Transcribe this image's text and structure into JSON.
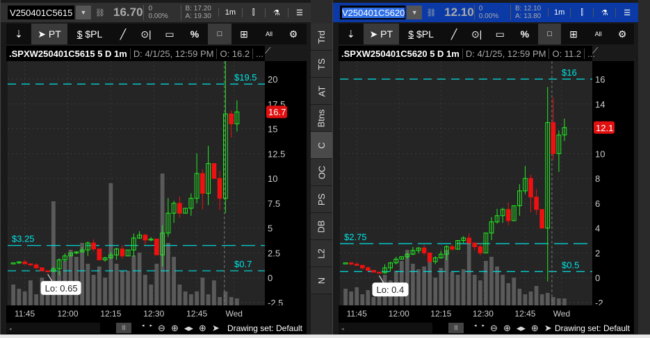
{
  "panels": [
    {
      "symbol": "V250401C5615",
      "last": "16.70",
      "change": "0",
      "change_pct": "0.00%",
      "bid": "B: 17.20",
      "ask": "A: 19.30",
      "interval": "1m",
      "toolbar": {
        "pin": "⇣",
        "pointer": "PT",
        "pl": "$PL",
        "percent": "%",
        "all": "All"
      },
      "title": ".SPXW250401C5615 5 D 1m",
      "date": "D: 4/1/25, 12:59 PM",
      "open": "O: 16.2",
      "more": "...",
      "price_tag": "16.7",
      "lo_label": "Lo: 0.65",
      "levels": [
        {
          "label": "$19.5",
          "value": 19.5
        },
        {
          "label": "$3.25",
          "value": 3.25
        },
        {
          "label": "$0.7",
          "value": 0.7
        }
      ],
      "yticks": [
        "20",
        "17.5",
        "15",
        "12.5",
        "10",
        "7.5",
        "5",
        "2.5",
        "0",
        "-2.5"
      ],
      "xticks": [
        "11:45",
        "12:00",
        "12:15",
        "12:30",
        "12:45",
        "Wed"
      ],
      "drawing_set": "Drawing set: Default"
    },
    {
      "symbol": "V250401C5620",
      "last": "12.10",
      "change": "0",
      "change_pct": "0.00%",
      "bid": "B: 12.10",
      "ask": "A: 13.80",
      "interval": "1m",
      "toolbar": {
        "pin": "⇣",
        "pointer": "PT",
        "pl": "$PL",
        "percent": "%",
        "all": "All"
      },
      "title": ".SPXW250401C5620 5 D 1m",
      "date": "D: 4/1/25, 12:59 PM",
      "open": "O: 11.2",
      "more": "...",
      "price_tag": "12.1",
      "lo_label": "Lo: 0.4",
      "levels": [
        {
          "label": "$16",
          "value": 16
        },
        {
          "label": "$2.75",
          "value": 2.75
        },
        {
          "label": "$0.5",
          "value": 0.5
        }
      ],
      "yticks": [
        "16",
        "14",
        "12",
        "10",
        "8",
        "6",
        "4",
        "2",
        "0",
        "-2"
      ],
      "xticks": [
        "11:45",
        "12:00",
        "12:15",
        "12:30",
        "12:45",
        "Wed"
      ],
      "drawing_set": "Drawing set: Default"
    }
  ],
  "side_tabs": [
    "Trd",
    "TS",
    "AT",
    "Btns",
    "C",
    "OC",
    "PS",
    "DB",
    "L2",
    "N"
  ],
  "active_tab": "C",
  "colors": {
    "up": "#22ee22",
    "down": "#ee1111",
    "level": "#00e5e5",
    "volume": "#5a5a5a",
    "tag": "#e01010"
  },
  "chart_data": [
    {
      "type": "candlestick",
      "title": ".SPXW250401C5615 5 D 1m",
      "ylim": [
        -2.5,
        21
      ],
      "yticks": [
        20,
        17.5,
        15,
        12.5,
        10,
        7.5,
        5,
        2.5,
        0,
        -2.5
      ],
      "x_start": "11:40",
      "bar_minutes": 2,
      "close": [
        1.5,
        1.6,
        1.4,
        1.3,
        1.0,
        0.7,
        0.65,
        0.9,
        1.8,
        2.2,
        2.5,
        2.6,
        2.8,
        3.5,
        2.9,
        1.8,
        2.0,
        2.3,
        2.9,
        2.2,
        2.8,
        4.0,
        4.3,
        3.8,
        3.9,
        2.3,
        4.5,
        6.5,
        7.5,
        6.5,
        7.0,
        8.0,
        10.5,
        8.5,
        11.5,
        10.0,
        8.0,
        16.5,
        15.5,
        16.7
      ],
      "volume": [
        1.5,
        1.2,
        1,
        1.8,
        0.8,
        2,
        1.5,
        7.5,
        2.5,
        3.2,
        4,
        3.5,
        4.5,
        3,
        2.2,
        2.8,
        2,
        8.8,
        3,
        2.5,
        2.5,
        3.6,
        3.8,
        2.2,
        1.5,
        3,
        9.5,
        4.5,
        3.5,
        1.5,
        1,
        0.8,
        1,
        2,
        0.8,
        1.8,
        0.6,
        1,
        0.6,
        0.5
      ]
    },
    {
      "type": "candlestick",
      "title": ".SPXW250401C5620 5 D 1m",
      "ylim": [
        -2,
        17
      ],
      "yticks": [
        16,
        14,
        12,
        10,
        8,
        6,
        4,
        2,
        0,
        -2
      ],
      "x_start": "11:40",
      "bar_minutes": 2,
      "close": [
        1.2,
        1.1,
        1.0,
        0.8,
        0.6,
        0.45,
        0.4,
        0.8,
        1.2,
        1.5,
        1.7,
        1.9,
        2.2,
        2.4,
        2.0,
        1.3,
        1.6,
        1.9,
        2.5,
        2.3,
        3.0,
        3.2,
        2.8,
        2.5,
        2.0,
        3.6,
        4.5,
        5.0,
        5.5,
        4.6,
        5.8,
        7.0,
        8.0,
        6.5,
        5.5,
        4.0,
        12.5,
        10.0,
        11.5,
        12.1
      ],
      "volume": [
        1.2,
        1,
        1.3,
        0.8,
        1.1,
        0.6,
        1,
        2.2,
        1.8,
        2.5,
        3.2,
        4,
        3,
        2.6,
        2.8,
        3.5,
        2,
        2.7,
        4,
        2.4,
        2.2,
        2.6,
        4.5,
        2.2,
        1.8,
        3.2,
        3.5,
        2.8,
        2.2,
        1.6,
        2,
        1.2,
        0.8,
        1,
        1.4,
        0.8,
        0.9,
        0.6,
        0.5,
        0.5
      ]
    }
  ]
}
